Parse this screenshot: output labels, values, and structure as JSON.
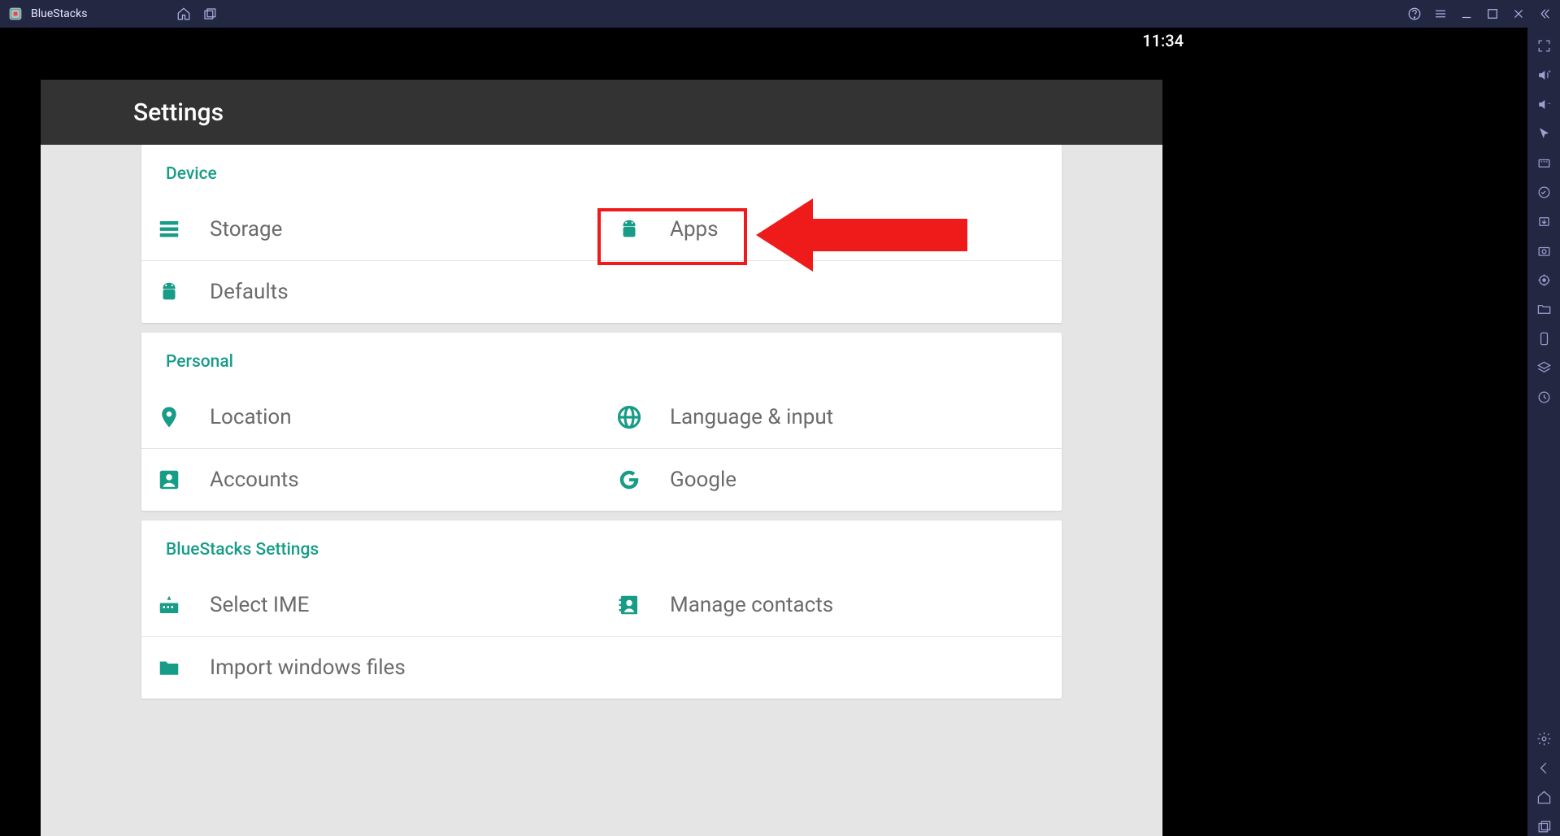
{
  "app": {
    "title": "BlueStacks",
    "time": "11:34"
  },
  "settings": {
    "title": "Settings",
    "sections": {
      "device": {
        "title": "Device",
        "storage": "Storage",
        "apps": "Apps",
        "defaults": "Defaults"
      },
      "personal": {
        "title": "Personal",
        "location": "Location",
        "language": "Language & input",
        "accounts": "Accounts",
        "google": "Google"
      },
      "bluestacks": {
        "title": "BlueStacks Settings",
        "select_ime": "Select IME",
        "manage_contacts": "Manage contacts",
        "import_windows": "Import windows files"
      }
    }
  },
  "annotation": {
    "highlight_target": "apps"
  }
}
